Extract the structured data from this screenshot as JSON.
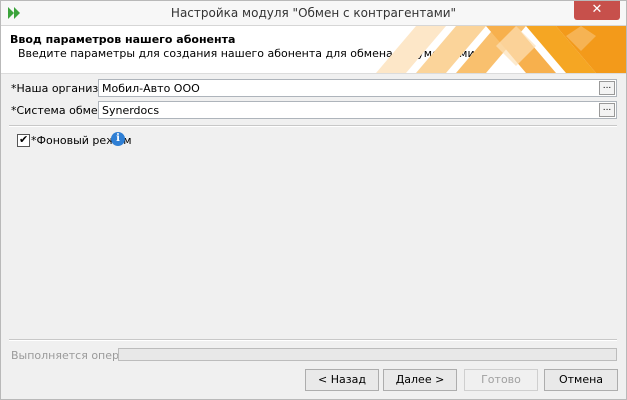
{
  "window": {
    "title": "Настройка модуля \"Обмен с контрагентами\"",
    "close_glyph": "✕"
  },
  "header": {
    "title": "Ввод параметров нашего абонента",
    "subtitle": "Введите параметры для создания нашего абонента для обмена документами."
  },
  "fields": [
    {
      "label": "*Наша организация:",
      "value": "Мобил-Авто ООО",
      "button": "..."
    },
    {
      "label": "*Система обмена:",
      "value": "Synerdocs",
      "button": "..."
    }
  ],
  "background_mode": {
    "label": "*Фоновый режим",
    "checked": true,
    "check_glyph": "✔",
    "info_glyph": "i"
  },
  "status": {
    "label": "Выполняется операция",
    "progress": 0
  },
  "buttons": {
    "back": "< Назад",
    "next": "Далее >",
    "finish": "Готово",
    "cancel": "Отмена"
  },
  "colors": {
    "accent_orange": "#f5a623",
    "title_close": "#c7504b",
    "info_blue": "#2f7fd4"
  }
}
